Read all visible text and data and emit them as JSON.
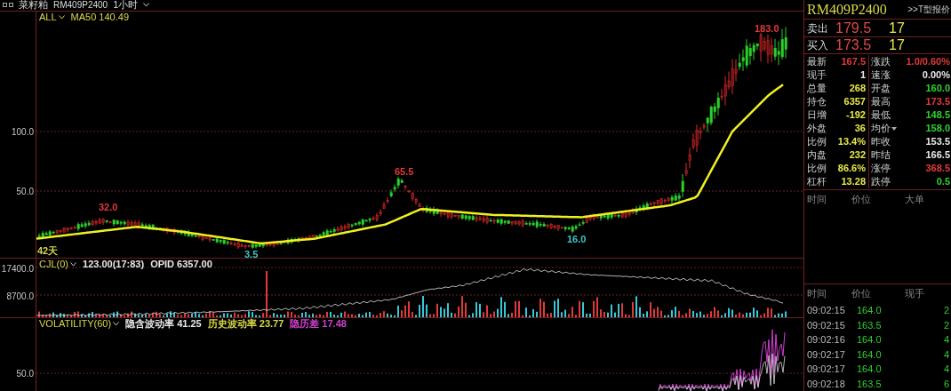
{
  "header": {
    "product": "菜籽粕",
    "contract": "RM409P2400",
    "period": "1小时"
  },
  "main_panel": {
    "selector": "ALL",
    "indicator": "MA50 140.49",
    "axis_labels": [
      "100.0",
      "50.0"
    ],
    "price_marks": [
      {
        "text": "32.0",
        "color": "#e03a3a"
      },
      {
        "text": "65.5",
        "color": "#e03a3a"
      },
      {
        "text": "3.5",
        "color": "#3cc8c8"
      },
      {
        "text": "16.0",
        "color": "#3cc8c8"
      },
      {
        "text": "183.0",
        "color": "#e03a3a"
      }
    ],
    "days_label": "42天"
  },
  "volume_panel": {
    "selector": "CJL(0)",
    "readings": [
      {
        "text": "123.00(17:83)",
        "color": "#e8e8e8"
      },
      {
        "text": "OPID 6357.00",
        "color": "#e8e8e8"
      }
    ],
    "axis_labels": [
      "17400.0",
      "8700.0"
    ]
  },
  "volatility_panel": {
    "selector": "VOLATILITY(60)",
    "readings": [
      {
        "text": "隐含波动率 41.25",
        "color": "#e8e8e8"
      },
      {
        "text": "历史波动率 23.77",
        "color": "#d8d84a"
      },
      {
        "text": "隐历差 17.48",
        "color": "#d040d0"
      }
    ],
    "axis_labels": [
      "50.0"
    ]
  },
  "quote": {
    "symbol": "RM409P2400",
    "link": ">>T型报价",
    "ask": {
      "label": "卖出",
      "price": "179.5",
      "size": "17"
    },
    "bid": {
      "label": "买入",
      "price": "173.5",
      "size": "17"
    },
    "rows": [
      {
        "left": {
          "label": "最新",
          "value": "167.5",
          "color": "#e03a3a"
        },
        "right": {
          "label": "涨跌",
          "value": "1.0/0.60%",
          "color": "#e03a3a"
        }
      },
      {
        "left": {
          "label": "现手",
          "value": "1",
          "color": "#e8e8e8"
        },
        "right": {
          "label": "速涨",
          "value": "0.00%",
          "color": "#e8e8e8"
        }
      },
      {
        "left": {
          "label": "总量",
          "value": "268",
          "color": "#e8e84a"
        },
        "right": {
          "label": "开盘",
          "value": "160.0",
          "color": "#30d030"
        }
      },
      {
        "left": {
          "label": "持仓",
          "value": "6357",
          "color": "#e8e84a"
        },
        "right": {
          "label": "最高",
          "value": "173.5",
          "color": "#e03a3a"
        }
      },
      {
        "left": {
          "label": "日增",
          "value": "-192",
          "color": "#e8e84a"
        },
        "right": {
          "label": "最低",
          "value": "148.5",
          "color": "#30d030"
        }
      },
      {
        "left": {
          "label": "外盘",
          "value": "36",
          "color": "#e8e84a"
        },
        "right": {
          "label": "均价",
          "value": "158.0",
          "color": "#30d030",
          "caret": true
        }
      },
      {
        "left": {
          "label": "比例",
          "value": "13.4%",
          "color": "#e8e84a"
        },
        "right": {
          "label": "昨收",
          "value": "153.5",
          "color": "#e8e8e8"
        }
      },
      {
        "left": {
          "label": "内盘",
          "value": "232",
          "color": "#e8e84a"
        },
        "right": {
          "label": "昨结",
          "value": "166.5",
          "color": "#e8e8e8"
        }
      },
      {
        "left": {
          "label": "比例",
          "value": "86.6%",
          "color": "#e8e84a"
        },
        "right": {
          "label": "涨停",
          "value": "368.5",
          "color": "#e03a3a"
        }
      },
      {
        "left": {
          "label": "杠杆",
          "value": "13.28",
          "color": "#e8e84a"
        },
        "right": {
          "label": "跌停",
          "value": "0.5",
          "color": "#30d030"
        }
      }
    ],
    "big_orders": {
      "columns": [
        "时间",
        "价位",
        "大单"
      ]
    },
    "ticks": {
      "columns": [
        "时间",
        "价位",
        "现手"
      ],
      "rows": [
        [
          "09:02:15",
          "164.0",
          "2"
        ],
        [
          "09:02:15",
          "163.5",
          "2"
        ],
        [
          "09:02:16",
          "164.0",
          "4"
        ],
        [
          "09:02:17",
          "164.0",
          "4"
        ],
        [
          "09:02:17",
          "164.0",
          "4"
        ],
        [
          "09:02:18",
          "163.5",
          "6"
        ]
      ]
    }
  }
}
